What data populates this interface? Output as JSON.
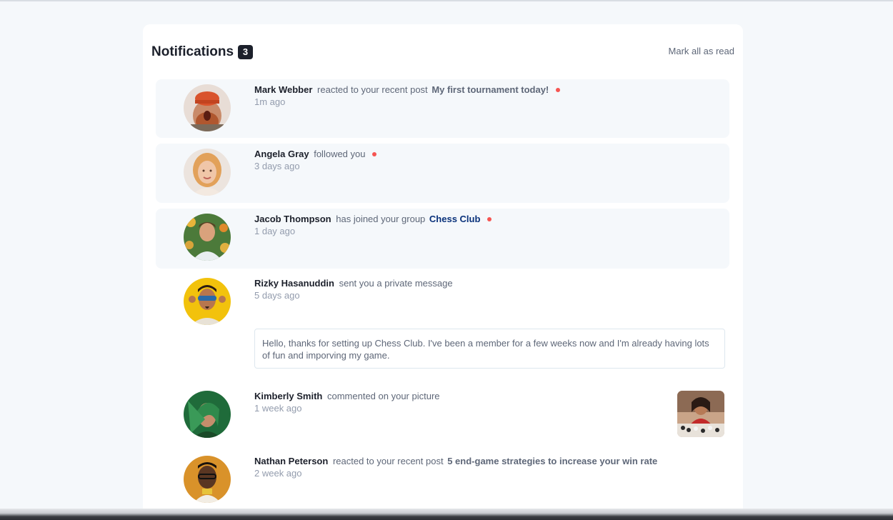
{
  "header": {
    "title": "Notifications",
    "unread_count": "3",
    "mark_all_label": "Mark all as read"
  },
  "notifications": [
    {
      "name": "Mark Webber",
      "action": "reacted to your recent post",
      "target": "My first tournament today!",
      "time": "1m ago",
      "unread": true,
      "avatar_icon": "mark-webber-avatar"
    },
    {
      "name": "Angela Gray",
      "action": "followed you",
      "target": "",
      "time": "3  days ago",
      "unread": true,
      "avatar_icon": "angela-gray-avatar"
    },
    {
      "name": "Jacob Thompson",
      "action": "has joined your group",
      "target": "Chess Club",
      "time": "1  day ago",
      "unread": true,
      "avatar_icon": "jacob-thompson-avatar"
    },
    {
      "name": "Rizky Hasanuddin",
      "action": "sent you a private message",
      "target": "",
      "time": "5  days ago",
      "unread": false,
      "avatar_icon": "rizky-hasanuddin-avatar",
      "message": "Hello, thanks for setting up Chess Club. I've been a member for a few weeks now and I'm already having lots of fun and imporving my game."
    },
    {
      "name": "Kimberly Smith",
      "action": "commented on your picture",
      "target": "",
      "time": "1  week ago",
      "unread": false,
      "avatar_icon": "kimberly-smith-avatar",
      "thumbnail_icon": "chess-picture-thumbnail"
    },
    {
      "name": "Nathan Peterson",
      "action": "reacted to your recent post",
      "target": "5 end-game strategies to increase your win rate",
      "time": "2  week ago",
      "unread": false,
      "avatar_icon": "nathan-peterson-avatar"
    }
  ],
  "colors": {
    "unread_dot": "#f65552",
    "group_link": "#0a327b",
    "unread_bg": "#f5f8fb"
  }
}
